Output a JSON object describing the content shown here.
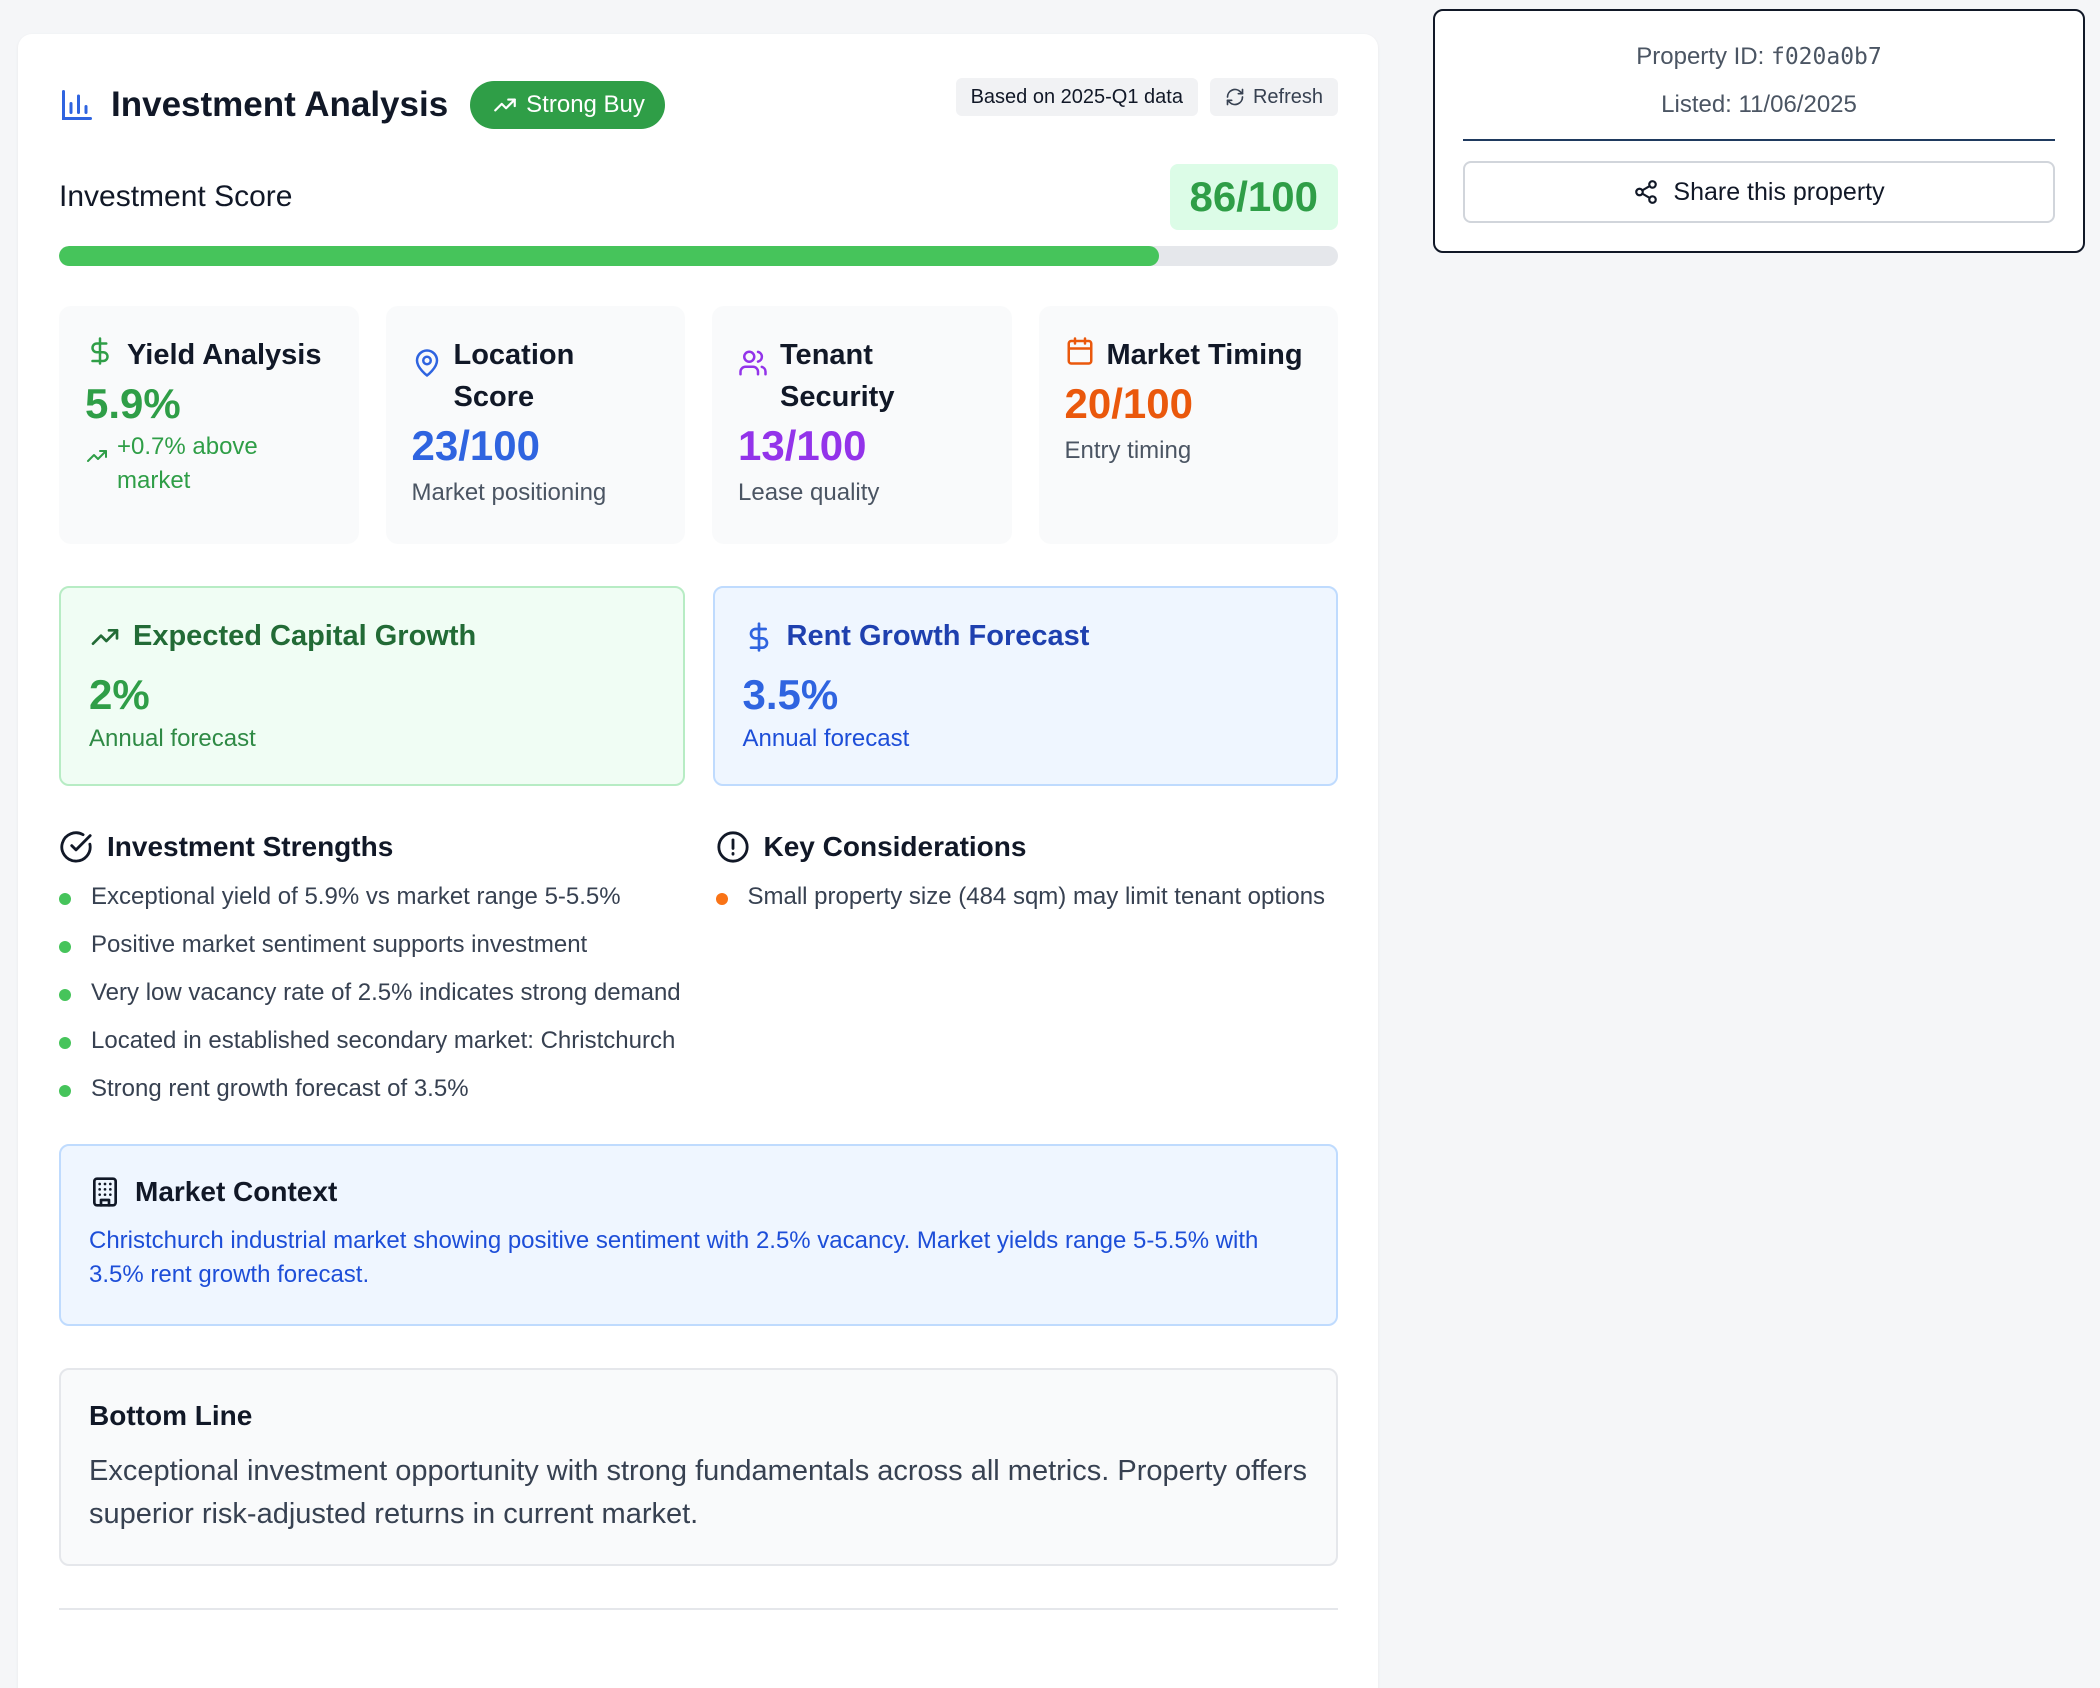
{
  "header": {
    "title": "Investment Analysis",
    "badge": "Strong Buy",
    "data_badge": "Based on 2025-Q1 data",
    "refresh_label": "Refresh"
  },
  "score": {
    "label": "Investment Score",
    "value_text": "86/100",
    "value": 86,
    "max": 100
  },
  "metrics": [
    {
      "title": "Yield Analysis",
      "value": "5.9%",
      "sub": "+0.7% above market",
      "icon": "dollar-icon",
      "color": "#2f9e47"
    },
    {
      "title": "Location Score",
      "value": "23/100",
      "sub": "Market positioning",
      "icon": "map-pin-icon",
      "color": "#2f64e0"
    },
    {
      "title": "Tenant Security",
      "value": "13/100",
      "sub": "Lease quality",
      "icon": "users-icon",
      "color": "#9333ea"
    },
    {
      "title": "Market Timing",
      "value": "20/100",
      "sub": "Entry timing",
      "icon": "calendar-icon",
      "color": "#ea580c"
    }
  ],
  "forecasts": [
    {
      "title": "Expected Capital Growth",
      "value": "2%",
      "sub": "Annual forecast",
      "icon": "trending-up-icon"
    },
    {
      "title": "Rent Growth Forecast",
      "value": "3.5%",
      "sub": "Annual forecast",
      "icon": "dollar-icon"
    }
  ],
  "strengths": {
    "title": "Investment Strengths",
    "items": [
      "Exceptional yield of 5.9% vs market range 5-5.5%",
      "Positive market sentiment supports investment",
      "Very low vacancy rate of 2.5% indicates strong demand",
      "Located in established secondary market: Christchurch",
      "Strong rent growth forecast of 3.5%"
    ]
  },
  "considerations": {
    "title": "Key Considerations",
    "items": [
      "Small property size (484 sqm) may limit tenant options"
    ]
  },
  "market_context": {
    "title": "Market Context",
    "text": "Christchurch industrial market showing positive sentiment with 2.5% vacancy. Market yields range 5-5.5% with 3.5% rent growth forecast."
  },
  "bottom_line": {
    "title": "Bottom Line",
    "text": "Exceptional investment opportunity with strong fundamentals across all metrics. Property offers superior risk-adjusted returns in current market."
  },
  "side": {
    "property_id_label": "Property ID: ",
    "property_id": "f020a0b7",
    "listed": "Listed: 11/06/2025",
    "share_label": "Share this property"
  },
  "colors": {
    "accent_green": "#2f9e47",
    "progress_green": "#46c45b",
    "blue": "#2f64e0",
    "purple": "#9333ea",
    "orange": "#ea580c"
  }
}
